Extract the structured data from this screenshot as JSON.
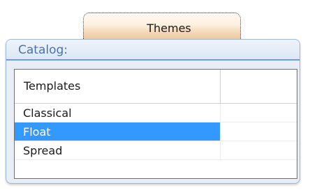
{
  "tab": {
    "label": "Themes"
  },
  "catalog": {
    "title": "Catalog:",
    "column_header": "Templates",
    "rows": [
      {
        "name": "Classical",
        "selected": false
      },
      {
        "name": "Float",
        "selected": true
      },
      {
        "name": "Spread",
        "selected": false
      }
    ]
  },
  "colors": {
    "selection": "#3399ff",
    "title_text": "#4a73a9",
    "header_underline": "#6e9ed6"
  }
}
